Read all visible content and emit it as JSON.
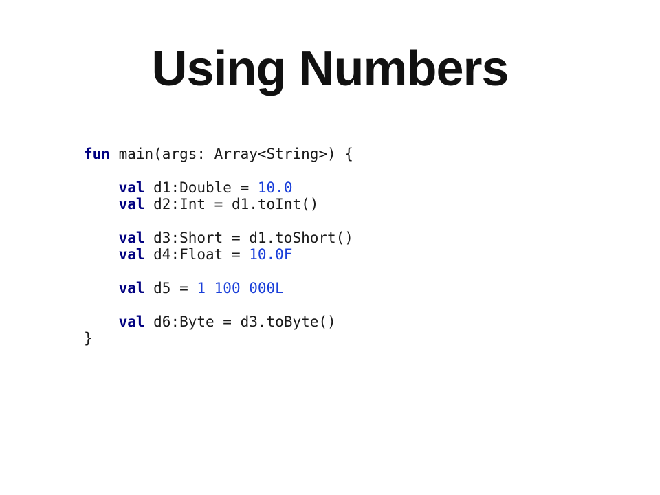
{
  "slide": {
    "title": "Using Numbers"
  },
  "code": {
    "lines": [
      [
        {
          "t": "fun",
          "k": "kw"
        },
        {
          "t": " main(args: Array<String>) {",
          "k": "plain"
        }
      ],
      [],
      [
        {
          "t": "    ",
          "k": "plain"
        },
        {
          "t": "val",
          "k": "kw"
        },
        {
          "t": " d1:Double = ",
          "k": "plain"
        },
        {
          "t": "10.0",
          "k": "num"
        }
      ],
      [
        {
          "t": "    ",
          "k": "plain"
        },
        {
          "t": "val",
          "k": "kw"
        },
        {
          "t": " d2:Int = d1.toInt()",
          "k": "plain"
        }
      ],
      [],
      [
        {
          "t": "    ",
          "k": "plain"
        },
        {
          "t": "val",
          "k": "kw"
        },
        {
          "t": " d3:Short = d1.toShort()",
          "k": "plain"
        }
      ],
      [
        {
          "t": "    ",
          "k": "plain"
        },
        {
          "t": "val",
          "k": "kw"
        },
        {
          "t": " d4:Float = ",
          "k": "plain"
        },
        {
          "t": "10.0F",
          "k": "num"
        }
      ],
      [],
      [
        {
          "t": "    ",
          "k": "plain"
        },
        {
          "t": "val",
          "k": "kw"
        },
        {
          "t": " d5 = ",
          "k": "plain"
        },
        {
          "t": "1_100_000L",
          "k": "num"
        }
      ],
      [],
      [
        {
          "t": "    ",
          "k": "plain"
        },
        {
          "t": "val",
          "k": "kw"
        },
        {
          "t": " d6:Byte = d3.toByte()",
          "k": "plain"
        }
      ],
      [
        {
          "t": "}",
          "k": "plain"
        }
      ]
    ],
    "colors": {
      "keyword": "#000080",
      "number": "#1a3fd9",
      "text": "#1a1a1a"
    }
  }
}
